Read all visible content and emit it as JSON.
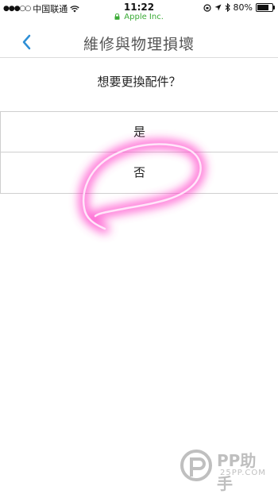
{
  "status_bar": {
    "signal": "●●●○○",
    "carrier": "中国联通",
    "time": "11:22",
    "battery": "80%",
    "battery_level": 0.8
  },
  "url_bar": {
    "domain": "Apple Inc."
  },
  "nav": {
    "title": "維修與物理損壞"
  },
  "question": "想要更換配件？",
  "options": {
    "yes": "是",
    "no": "否"
  },
  "watermark": {
    "brand": "PP助手",
    "site": "25PP.COM"
  },
  "colors": {
    "accent": "#2e8fd6",
    "secure": "#3aaa35",
    "highlight": "#ff3fc8"
  }
}
